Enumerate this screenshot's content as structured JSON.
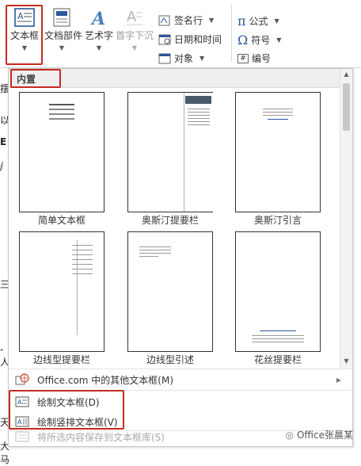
{
  "ribbon": {
    "textbox_label": "文本框",
    "docparts_label": "文档部件",
    "wordart_label": "艺术字",
    "dropcap_label": "首字下沉",
    "signature_label": "签名行",
    "datetime_label": "日期和时间",
    "object_label": "对象",
    "equation_label": "公式",
    "symbol_label": "符号",
    "number_label": "编号"
  },
  "doc_margin_chars": [
    "摆",
    "以",
    "E",
    "ⅉ",
    "三",
    "-人",
    "天",
    "大马"
  ],
  "gallery": {
    "section_title": "内置",
    "items": [
      {
        "label": "简单文本框"
      },
      {
        "label": "奥斯汀提要栏"
      },
      {
        "label": "奥斯汀引言"
      },
      {
        "label": "边线型提要栏"
      },
      {
        "label": "边线型引述"
      },
      {
        "label": "花丝提要栏"
      }
    ]
  },
  "menu": {
    "more_office": "Office.com 中的其他文本框(M)",
    "draw_textbox": "绘制文本框(D)",
    "draw_vertical": "绘制竖排文本框(V)",
    "save_selection": "将所选内容保存到文本框库(S)"
  },
  "watermark": "Office张晨某",
  "colors": {
    "highlight": "#c62b20",
    "accent": "#2b579a"
  }
}
